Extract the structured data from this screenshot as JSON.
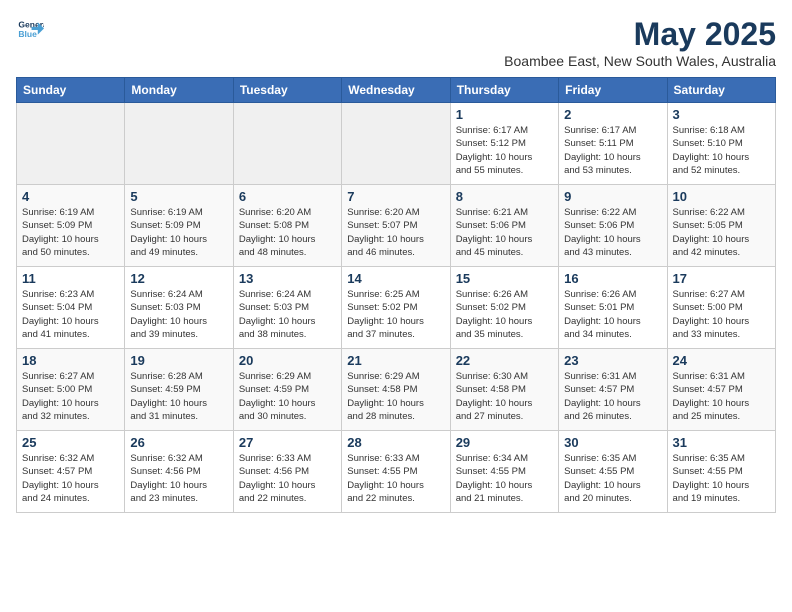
{
  "header": {
    "logo_line1": "General",
    "logo_line2": "Blue",
    "month_title": "May 2025",
    "location": "Boambee East, New South Wales, Australia"
  },
  "days_of_week": [
    "Sunday",
    "Monday",
    "Tuesday",
    "Wednesday",
    "Thursday",
    "Friday",
    "Saturday"
  ],
  "weeks": [
    [
      {
        "num": "",
        "info": ""
      },
      {
        "num": "",
        "info": ""
      },
      {
        "num": "",
        "info": ""
      },
      {
        "num": "",
        "info": ""
      },
      {
        "num": "1",
        "info": "Sunrise: 6:17 AM\nSunset: 5:12 PM\nDaylight: 10 hours\nand 55 minutes."
      },
      {
        "num": "2",
        "info": "Sunrise: 6:17 AM\nSunset: 5:11 PM\nDaylight: 10 hours\nand 53 minutes."
      },
      {
        "num": "3",
        "info": "Sunrise: 6:18 AM\nSunset: 5:10 PM\nDaylight: 10 hours\nand 52 minutes."
      }
    ],
    [
      {
        "num": "4",
        "info": "Sunrise: 6:19 AM\nSunset: 5:09 PM\nDaylight: 10 hours\nand 50 minutes."
      },
      {
        "num": "5",
        "info": "Sunrise: 6:19 AM\nSunset: 5:09 PM\nDaylight: 10 hours\nand 49 minutes."
      },
      {
        "num": "6",
        "info": "Sunrise: 6:20 AM\nSunset: 5:08 PM\nDaylight: 10 hours\nand 48 minutes."
      },
      {
        "num": "7",
        "info": "Sunrise: 6:20 AM\nSunset: 5:07 PM\nDaylight: 10 hours\nand 46 minutes."
      },
      {
        "num": "8",
        "info": "Sunrise: 6:21 AM\nSunset: 5:06 PM\nDaylight: 10 hours\nand 45 minutes."
      },
      {
        "num": "9",
        "info": "Sunrise: 6:22 AM\nSunset: 5:06 PM\nDaylight: 10 hours\nand 43 minutes."
      },
      {
        "num": "10",
        "info": "Sunrise: 6:22 AM\nSunset: 5:05 PM\nDaylight: 10 hours\nand 42 minutes."
      }
    ],
    [
      {
        "num": "11",
        "info": "Sunrise: 6:23 AM\nSunset: 5:04 PM\nDaylight: 10 hours\nand 41 minutes."
      },
      {
        "num": "12",
        "info": "Sunrise: 6:24 AM\nSunset: 5:03 PM\nDaylight: 10 hours\nand 39 minutes."
      },
      {
        "num": "13",
        "info": "Sunrise: 6:24 AM\nSunset: 5:03 PM\nDaylight: 10 hours\nand 38 minutes."
      },
      {
        "num": "14",
        "info": "Sunrise: 6:25 AM\nSunset: 5:02 PM\nDaylight: 10 hours\nand 37 minutes."
      },
      {
        "num": "15",
        "info": "Sunrise: 6:26 AM\nSunset: 5:02 PM\nDaylight: 10 hours\nand 35 minutes."
      },
      {
        "num": "16",
        "info": "Sunrise: 6:26 AM\nSunset: 5:01 PM\nDaylight: 10 hours\nand 34 minutes."
      },
      {
        "num": "17",
        "info": "Sunrise: 6:27 AM\nSunset: 5:00 PM\nDaylight: 10 hours\nand 33 minutes."
      }
    ],
    [
      {
        "num": "18",
        "info": "Sunrise: 6:27 AM\nSunset: 5:00 PM\nDaylight: 10 hours\nand 32 minutes."
      },
      {
        "num": "19",
        "info": "Sunrise: 6:28 AM\nSunset: 4:59 PM\nDaylight: 10 hours\nand 31 minutes."
      },
      {
        "num": "20",
        "info": "Sunrise: 6:29 AM\nSunset: 4:59 PM\nDaylight: 10 hours\nand 30 minutes."
      },
      {
        "num": "21",
        "info": "Sunrise: 6:29 AM\nSunset: 4:58 PM\nDaylight: 10 hours\nand 28 minutes."
      },
      {
        "num": "22",
        "info": "Sunrise: 6:30 AM\nSunset: 4:58 PM\nDaylight: 10 hours\nand 27 minutes."
      },
      {
        "num": "23",
        "info": "Sunrise: 6:31 AM\nSunset: 4:57 PM\nDaylight: 10 hours\nand 26 minutes."
      },
      {
        "num": "24",
        "info": "Sunrise: 6:31 AM\nSunset: 4:57 PM\nDaylight: 10 hours\nand 25 minutes."
      }
    ],
    [
      {
        "num": "25",
        "info": "Sunrise: 6:32 AM\nSunset: 4:57 PM\nDaylight: 10 hours\nand 24 minutes."
      },
      {
        "num": "26",
        "info": "Sunrise: 6:32 AM\nSunset: 4:56 PM\nDaylight: 10 hours\nand 23 minutes."
      },
      {
        "num": "27",
        "info": "Sunrise: 6:33 AM\nSunset: 4:56 PM\nDaylight: 10 hours\nand 22 minutes."
      },
      {
        "num": "28",
        "info": "Sunrise: 6:33 AM\nSunset: 4:55 PM\nDaylight: 10 hours\nand 22 minutes."
      },
      {
        "num": "29",
        "info": "Sunrise: 6:34 AM\nSunset: 4:55 PM\nDaylight: 10 hours\nand 21 minutes."
      },
      {
        "num": "30",
        "info": "Sunrise: 6:35 AM\nSunset: 4:55 PM\nDaylight: 10 hours\nand 20 minutes."
      },
      {
        "num": "31",
        "info": "Sunrise: 6:35 AM\nSunset: 4:55 PM\nDaylight: 10 hours\nand 19 minutes."
      }
    ]
  ]
}
